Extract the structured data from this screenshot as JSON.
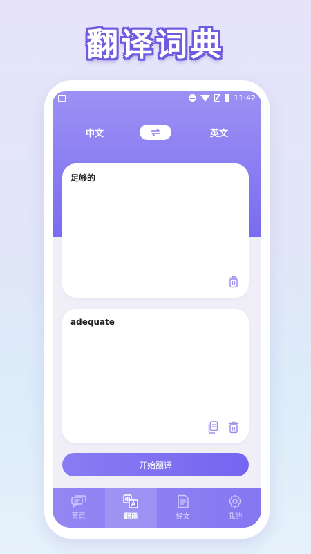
{
  "banner": {
    "title": "翻译词典"
  },
  "status_bar": {
    "time": "11:42"
  },
  "languages": {
    "source": "中文",
    "target": "英文",
    "swap_icon": "swap-arrows-icon"
  },
  "input_card": {
    "text": "足够的"
  },
  "output_card": {
    "text": "adequate"
  },
  "actions": {
    "translate_label": "开始翻译"
  },
  "tabs": [
    {
      "label": "首页",
      "icon": "chat-bubbles-icon",
      "active": false
    },
    {
      "label": "翻译",
      "icon": "translate-icon",
      "active": true
    },
    {
      "label": "好文",
      "icon": "document-icon",
      "active": false
    },
    {
      "label": "我的",
      "icon": "gear-icon",
      "active": false
    }
  ],
  "colors": {
    "accent": "#7a6cf0",
    "accent_light": "#9d91f4",
    "background": "#f0eff8"
  }
}
